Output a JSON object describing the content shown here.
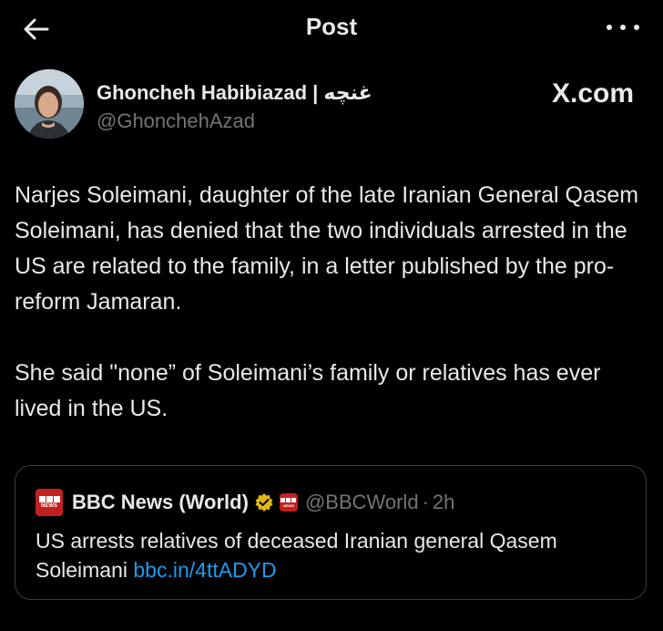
{
  "topbar": {
    "title": "Post"
  },
  "author": {
    "display_name": "Ghoncheh Habibiazad | غنچه",
    "handle": "@GhonchehAzad",
    "source": "X.com"
  },
  "post": {
    "paragraphs": [
      "Narjes Soleimani, daughter of the late Iranian General Qasem Soleimani, has denied that the two individuals arrested in the US are related to the family, in a letter published by the pro-reform Jamaran.",
      "She said \"none” of Soleimani’s family or relatives has ever lived in the US."
    ]
  },
  "quote": {
    "logo_text": "NEWS",
    "name": "BBC News (World)",
    "handle": "@BBCWorld",
    "separator": "·",
    "time": "2h",
    "text": "US arrests relatives of deceased Iranian general Qasem Soleimani ",
    "link": "bbc.in/4ttADYD",
    "colors": {
      "link": "#1d9bf0",
      "bbc_red": "#c41f1f",
      "verified_gold": "#e2b719"
    }
  },
  "icons": [
    "back-arrow-icon",
    "more-icon",
    "verified-badge-icon",
    "bbc-news-logo"
  ]
}
